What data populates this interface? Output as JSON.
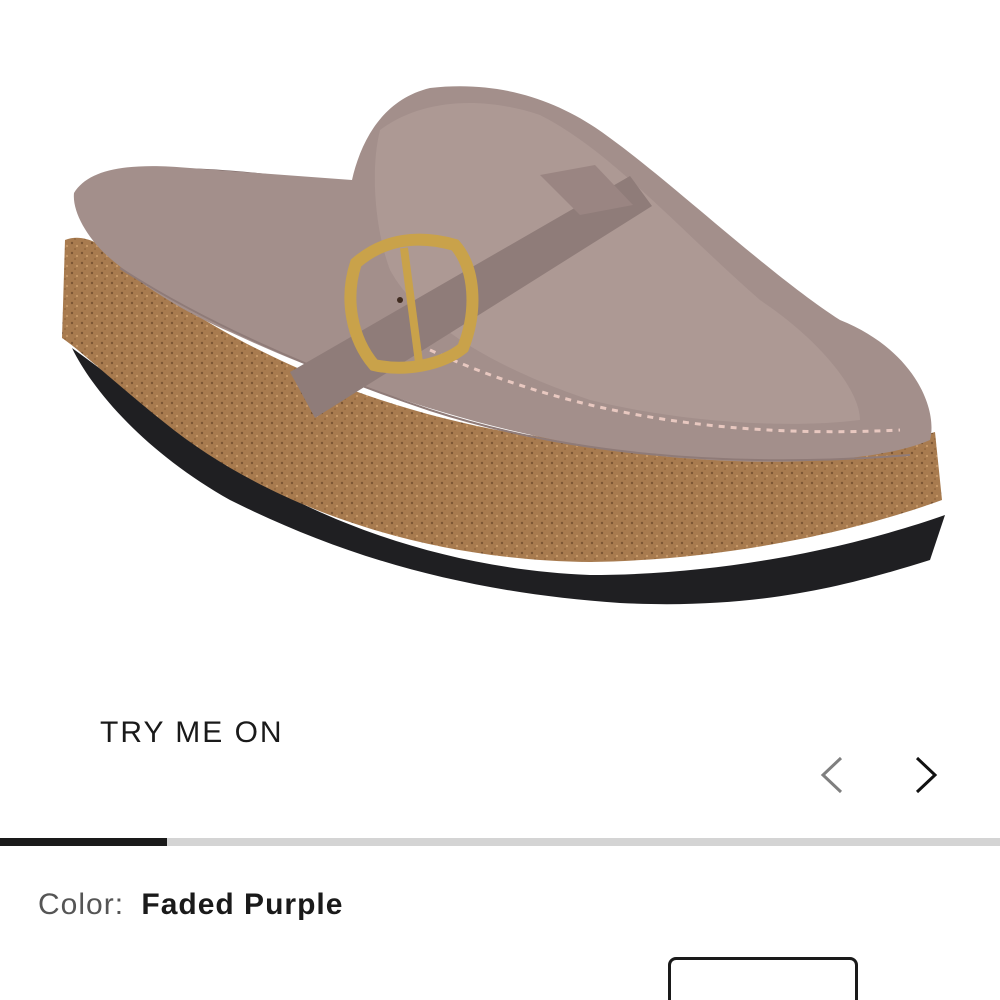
{
  "product": {
    "image_name": "faded-purple-buckle-clog-image",
    "try_on_label": "TRY ME ON",
    "color_label": "Color:",
    "color_value": "Faded Purple"
  },
  "gallery": {
    "progress_fraction": 0.167,
    "prev_icon": "chevron-left-icon",
    "next_icon": "chevron-right-icon"
  },
  "colors": {
    "upper": "#a38f8b",
    "cork": "#a87b4f",
    "sole": "#1f1f22",
    "buckle": "#c9a24a"
  }
}
